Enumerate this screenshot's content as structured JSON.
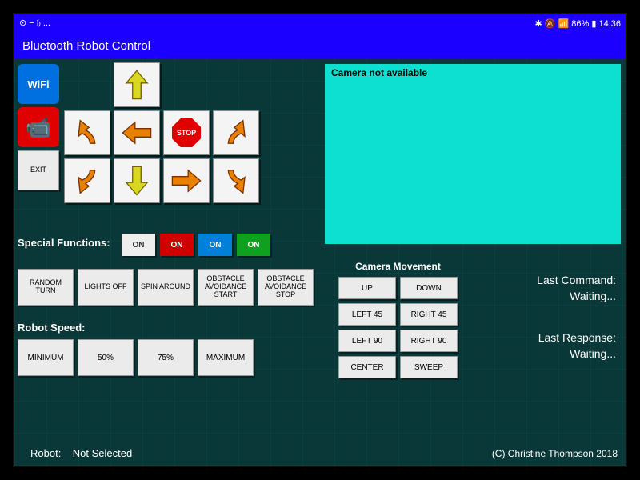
{
  "status_bar": {
    "left_text": "⊙ − 𝔥 ...",
    "right_text": "✱ 🔕 📶 86% ▮ 14:36"
  },
  "app_title": "Bluetooth Robot Control",
  "left_icons": {
    "wifi_label": "WiFi",
    "exit_label": "EXIT"
  },
  "dpad": {
    "stop_label": "STOP"
  },
  "camera": {
    "label": "Camera not available"
  },
  "special_functions": {
    "title": "Special Functions:",
    "toggles": [
      "ON",
      "ON",
      "ON",
      "ON"
    ],
    "buttons": [
      "RANDOM TURN",
      "LIGHTS OFF",
      "SPIN AROUND",
      "OBSTACLE AVOIDANCE START",
      "OBSTACLE AVOIDANCE STOP"
    ]
  },
  "speed": {
    "title": "Robot Speed:",
    "buttons": [
      "MINIMUM",
      "50%",
      "75%",
      "MAXIMUM"
    ]
  },
  "camera_movement": {
    "title": "Camera Movement",
    "buttons": [
      "UP",
      "DOWN",
      "LEFT 45",
      "RIGHT 45",
      "LEFT 90",
      "RIGHT 90",
      "CENTER",
      "SWEEP"
    ]
  },
  "status": {
    "last_command_label": "Last Command:",
    "last_command_value": "Waiting...",
    "last_response_label": "Last Response:",
    "last_response_value": "Waiting..."
  },
  "robot": {
    "label": "Robot:",
    "value": "Not Selected"
  },
  "copyright": "(C) Christine Thompson 2018"
}
